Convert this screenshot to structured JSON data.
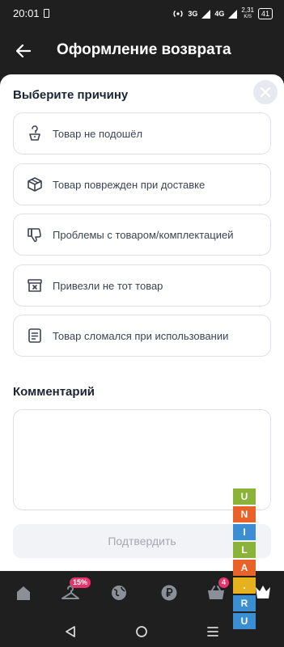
{
  "status_bar": {
    "time": "20:01",
    "network_a": "3G",
    "network_b": "4G",
    "speed": "2,31",
    "speed_unit": "K/S",
    "battery": "41"
  },
  "header": {
    "title": "Оформление возврата"
  },
  "reasons_section": {
    "title": "Выберите причину",
    "items": [
      {
        "label": "Товар не подошёл",
        "icon": "hanger-tag-icon"
      },
      {
        "label": "Товар поврежден при доставке",
        "icon": "damaged-box-icon"
      },
      {
        "label": "Проблемы с товаром/комплектацией",
        "icon": "thumbs-down-icon"
      },
      {
        "label": "Привезли не тот товар",
        "icon": "box-x-icon"
      },
      {
        "label": "Товар сломался при использовании",
        "icon": "document-icon"
      }
    ]
  },
  "comment_section": {
    "title": "Комментарий",
    "value": ""
  },
  "confirm_button": {
    "label": "Подтвердить"
  },
  "tab_bar": {
    "tabs": [
      "home-icon",
      "hanger-icon",
      "globe-icon",
      "ruble-icon",
      "basket-icon",
      "profile-icon"
    ],
    "hanger_badge": "15%",
    "basket_badge": "4"
  },
  "watermark": {
    "letters": [
      "U",
      "N",
      "I",
      "L",
      "A",
      ".",
      "R",
      "U"
    ],
    "colors": [
      "#8bb33a",
      "#e8622a",
      "#3b8ed1",
      "#8bb33a",
      "#e8622a",
      "#e5b21e",
      "#3b8ed1",
      "#3b8ed1"
    ]
  },
  "colors": {
    "header_bg": "#1f1f1f",
    "card_border": "#dde1e7",
    "badge": "#e5356f"
  }
}
